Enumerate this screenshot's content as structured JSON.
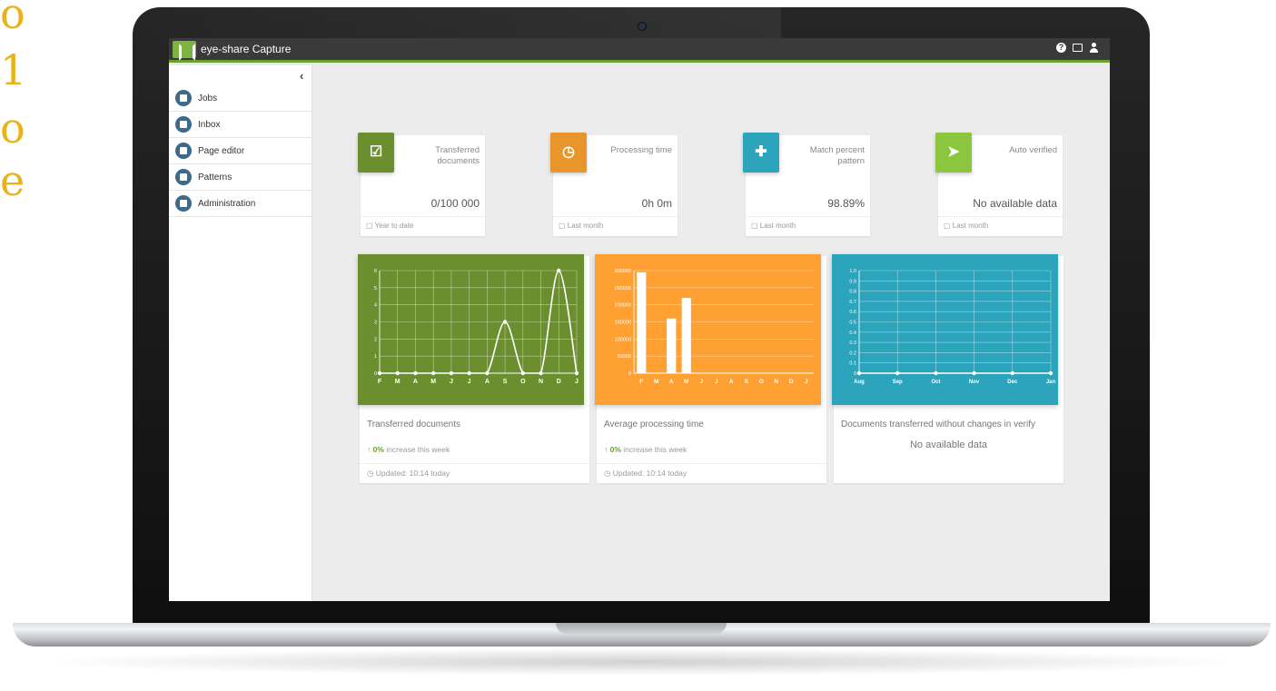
{
  "app": {
    "title": "eye-share Capture"
  },
  "edge_glyphs": [
    "o",
    "1",
    "o",
    "e"
  ],
  "topbar": {
    "icons": [
      "help-icon",
      "message-icon",
      "user-icon"
    ]
  },
  "sidebar": {
    "collapse_glyph": "‹",
    "items": [
      {
        "label": "Jobs",
        "icon": "jobs-icon"
      },
      {
        "label": "Inbox",
        "icon": "inbox-icon"
      },
      {
        "label": "Page editor",
        "icon": "page-editor-icon"
      },
      {
        "label": "Patterns",
        "icon": "patterns-icon"
      },
      {
        "label": "Administration",
        "icon": "administration-icon"
      }
    ]
  },
  "stats": [
    {
      "title": "Transferred documents",
      "value": "0/100 000",
      "footer": "Year to date",
      "color": "#6b8e2f",
      "icon": "clipboard-check-icon",
      "glyph": "☑"
    },
    {
      "title": "Processing time",
      "value": "0h 0m",
      "footer": "Last month",
      "color": "#e8952c",
      "icon": "clock-icon",
      "glyph": "◷"
    },
    {
      "title": "Match percent pattern",
      "value": "98.89%",
      "footer": "Last month",
      "color": "#2ba4bc",
      "icon": "puzzle-icon",
      "glyph": "✚"
    },
    {
      "title": "Auto verified",
      "value": "No available data",
      "footer": "Last month",
      "color": "#8cc63e",
      "icon": "send-icon",
      "glyph": "➤"
    }
  ],
  "cards": [
    {
      "title": "Transferred documents",
      "stat_arrow": "↑",
      "stat_pct": "0%",
      "stat_text": "increase this week",
      "footer": "Updated: 10:14 today",
      "color": "#6b8e2f"
    },
    {
      "title": "Average processing time",
      "stat_arrow": "↑",
      "stat_pct": "0%",
      "stat_text": "increase this week",
      "footer": "Updated: 10:14 today",
      "color": "#ffa033"
    },
    {
      "title": "Documents transferred without changes in verify",
      "no_data": "No available data",
      "color": "#2ba4bc"
    }
  ],
  "chart_data": [
    {
      "type": "line",
      "categories": [
        "F",
        "M",
        "A",
        "M",
        "J",
        "J",
        "A",
        "S",
        "O",
        "N",
        "D",
        "J"
      ],
      "values": [
        0,
        0,
        0,
        0,
        0,
        0,
        0,
        3,
        0,
        0,
        6,
        0
      ],
      "yticks": [
        "0",
        "1",
        "2",
        "3",
        "4",
        "5",
        "6"
      ],
      "ylim": [
        0,
        6
      ],
      "grid": true
    },
    {
      "type": "bar",
      "categories": [
        "F",
        "M",
        "A",
        "M",
        "J",
        "J",
        "A",
        "S",
        "O",
        "N",
        "D",
        "J"
      ],
      "values": [
        295000,
        0,
        160000,
        220000,
        0,
        0,
        0,
        0,
        0,
        0,
        0,
        0
      ],
      "yticks": [
        "0",
        "50000",
        "100000",
        "150000",
        "200000",
        "250000",
        "300000"
      ],
      "ylim": [
        0,
        300000
      ],
      "grid": true
    },
    {
      "type": "line",
      "categories": [
        "Aug",
        "Sep",
        "Oct",
        "Nov",
        "Dec",
        "Jan"
      ],
      "values": [
        0,
        0,
        0,
        0,
        0,
        0
      ],
      "yticks": [
        "0",
        "0.1",
        "0.2",
        "0.3",
        "0.4",
        "0.5",
        "0.6",
        "0.7",
        "0.8",
        "0.9",
        "1.0"
      ],
      "ylim": [
        0,
        1
      ],
      "grid": true
    }
  ]
}
